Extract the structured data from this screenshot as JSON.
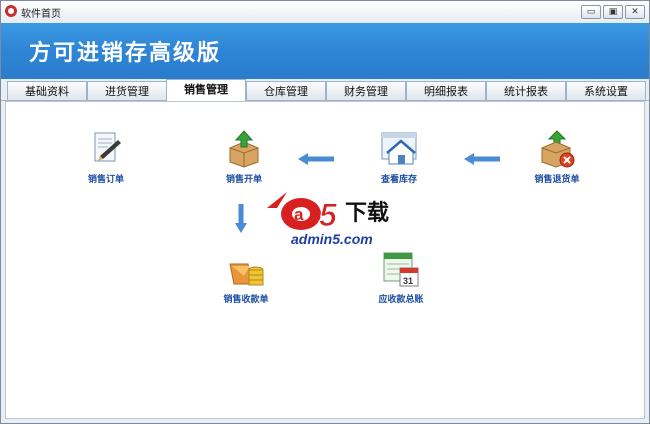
{
  "window": {
    "title": "软件首页",
    "buttons": {
      "minimize": "▭",
      "restore": "▣",
      "close": "✕"
    }
  },
  "banner": {
    "title": "方可进销存高级版"
  },
  "tabs": [
    {
      "label": "基础资料"
    },
    {
      "label": "进货管理"
    },
    {
      "label": "销售管理",
      "active": true
    },
    {
      "label": "仓库管理"
    },
    {
      "label": "财务管理"
    },
    {
      "label": "明细报表"
    },
    {
      "label": "统计报表"
    },
    {
      "label": "系统设置"
    }
  ],
  "items": {
    "sales_order": {
      "label": "销售订单",
      "icon": "document-pen-icon"
    },
    "sales_invoice": {
      "label": "销售开单",
      "icon": "box-up-arrow-icon"
    },
    "view_stock": {
      "label": "查看库存",
      "icon": "warehouse-icon"
    },
    "sales_return": {
      "label": "销售退货单",
      "icon": "box-return-icon"
    },
    "sales_receipt": {
      "label": "销售收款单",
      "icon": "money-box-icon"
    },
    "receivable_ledger": {
      "label": "应收款总账",
      "icon": "calendar-ledger-icon"
    }
  },
  "watermark": {
    "brand_left": "a",
    "brand_num": "5",
    "brand_right": "下载",
    "domain": "admin5.com"
  },
  "colors": {
    "banner": "#2f86d6",
    "label": "#1e4fa2",
    "arrow": "#4a8bd6"
  }
}
